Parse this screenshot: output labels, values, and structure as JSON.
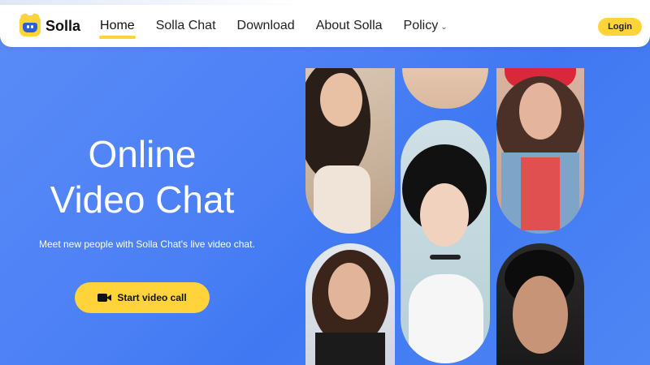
{
  "app": {
    "name": "Solla"
  },
  "nav": {
    "items": [
      {
        "label": "Home"
      },
      {
        "label": "Solla Chat"
      },
      {
        "label": "Download"
      },
      {
        "label": "About Solla"
      },
      {
        "label": "Policy"
      }
    ],
    "login_label": "Login"
  },
  "hero": {
    "title_line1": "Online",
    "title_line2": "Video Chat",
    "subtitle": "Meet new people with Solla Chat's live video chat.",
    "cta_label": "Start video call"
  },
  "colors": {
    "accent": "#ffd43b",
    "background": "#4a7ff5",
    "logo_face": "#2b5fd8"
  },
  "icons": [
    "solla-logo-icon",
    "chevron-down-icon",
    "video-camera-icon"
  ]
}
